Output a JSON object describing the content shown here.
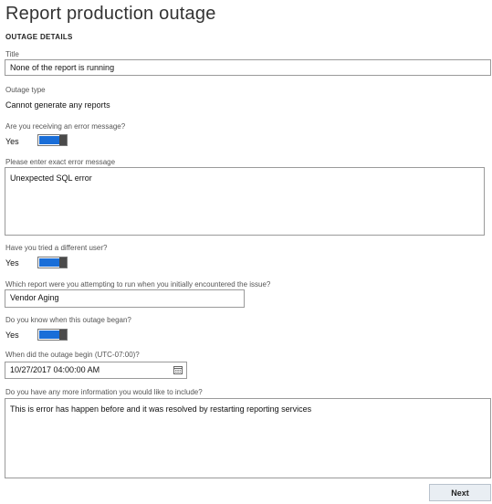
{
  "page": {
    "title": "Report production outage",
    "section_heading": "OUTAGE DETAILS"
  },
  "form": {
    "title_label": "Title",
    "title_value": "None of the report is running",
    "outage_type_label": "Outage type",
    "outage_type_value": "Cannot generate any reports",
    "error_message_question": "Are you receiving an error message?",
    "error_message_toggle_label": "Yes",
    "exact_error_label": "Please enter exact error message",
    "exact_error_value": "Unexpected SQL error",
    "different_user_question": "Have you tried a different user?",
    "different_user_toggle_label": "Yes",
    "report_attempted_label": "Which report were you attempting to run when you initially encountered the issue?",
    "report_attempted_value": "Vendor Aging",
    "outage_began_question": "Do you know when this outage began?",
    "outage_began_toggle_label": "Yes",
    "outage_begin_label": "When did the outage begin (UTC-07:00)?",
    "outage_begin_value": "10/27/2017 04:00:00 AM",
    "more_info_label": "Do you have any more information you would like to include?",
    "more_info_value": "This is error has happen before and it was resolved by restarting reporting services"
  },
  "toggles": {
    "error_message_on": true,
    "different_user_on": true,
    "outage_began_on": true
  },
  "icons": {
    "date_picker": "calendar-icon"
  },
  "colors": {
    "toggle_on": "#1a6ed8",
    "button_bg": "#e9eef3"
  },
  "actions": {
    "next_label": "Next"
  }
}
